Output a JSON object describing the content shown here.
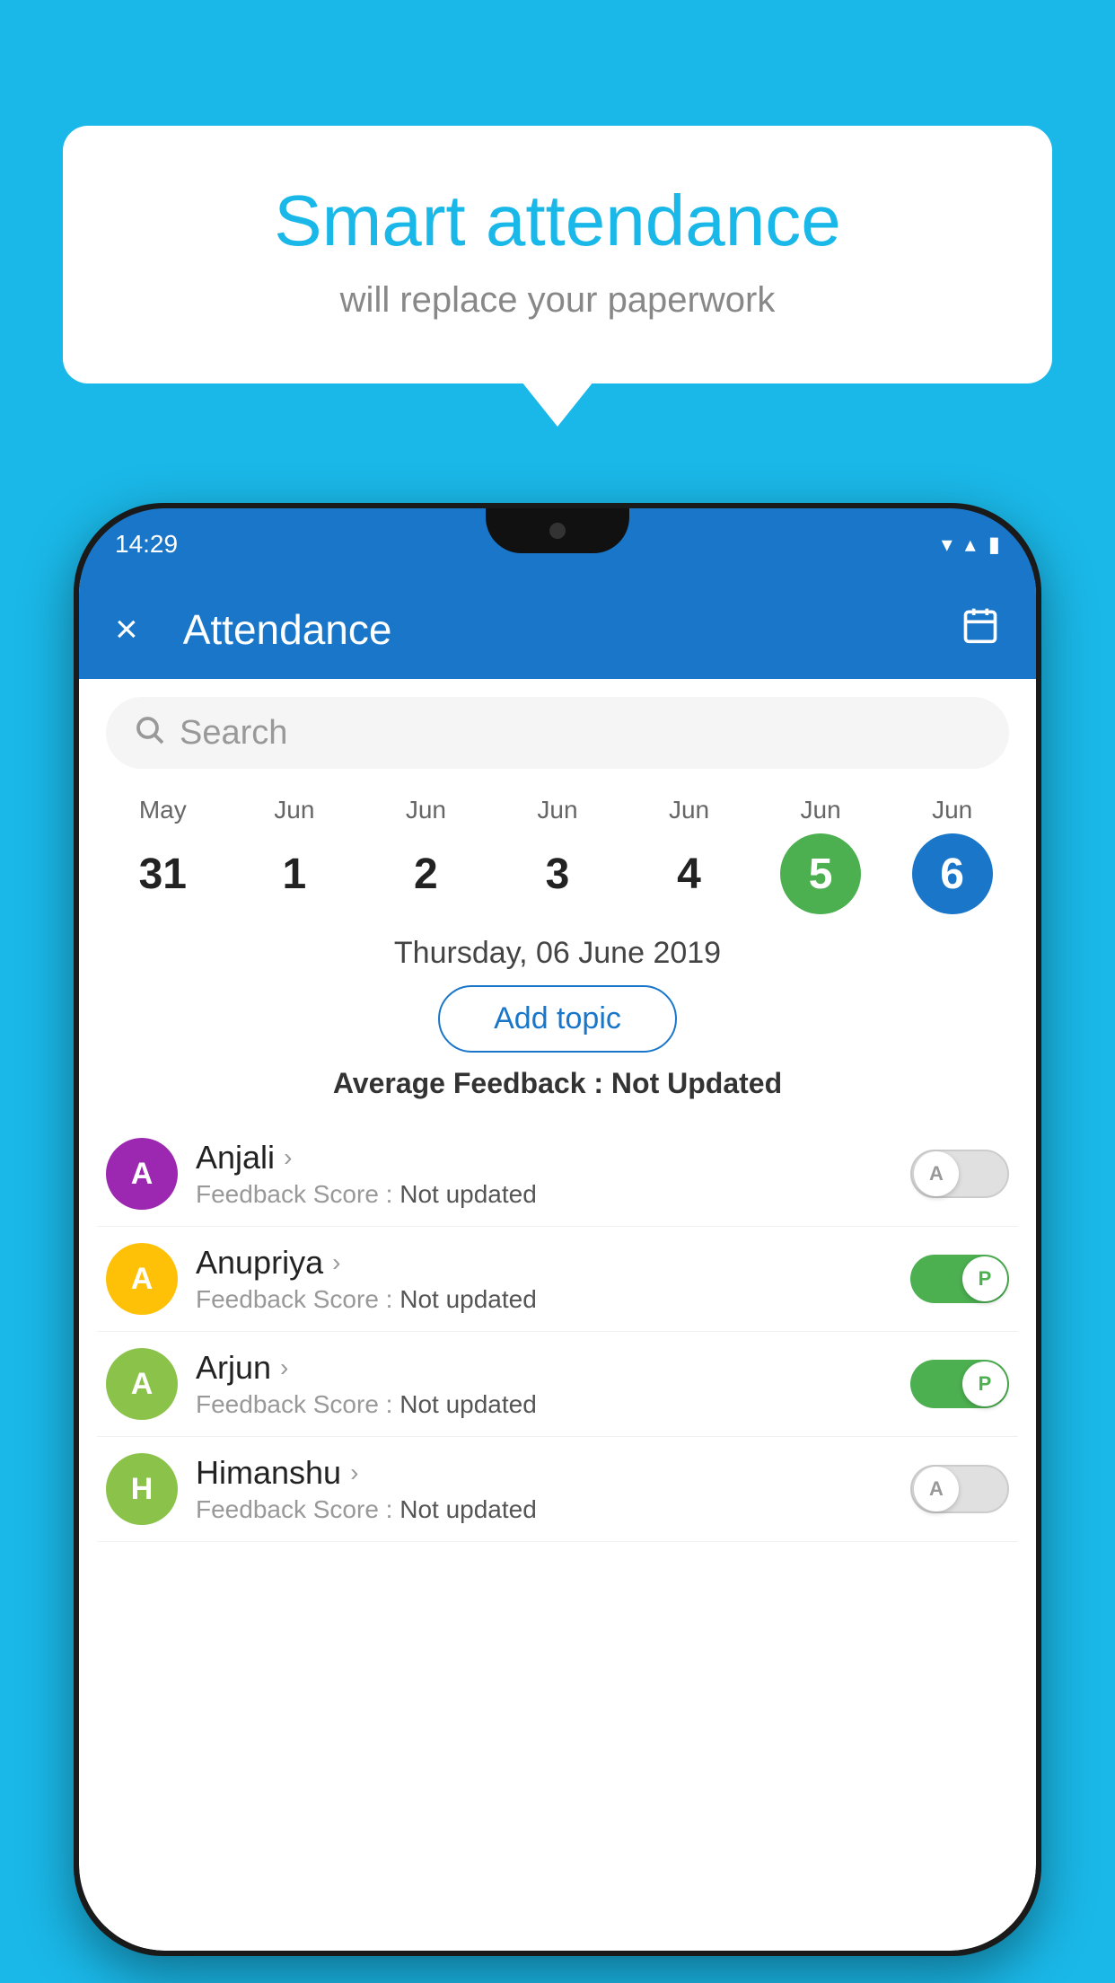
{
  "background": {
    "color": "#1ab8e8"
  },
  "speech_bubble": {
    "title": "Smart attendance",
    "subtitle": "will replace your paperwork"
  },
  "phone": {
    "status_bar": {
      "time": "14:29",
      "wifi_icon": "▼",
      "signal_icon": "▲",
      "battery_icon": "▮"
    },
    "header": {
      "close_label": "×",
      "title": "Attendance",
      "calendar_icon": "📅"
    },
    "search": {
      "placeholder": "Search"
    },
    "calendar": {
      "days": [
        {
          "month": "May",
          "date": "31",
          "style": "normal"
        },
        {
          "month": "Jun",
          "date": "1",
          "style": "normal"
        },
        {
          "month": "Jun",
          "date": "2",
          "style": "normal"
        },
        {
          "month": "Jun",
          "date": "3",
          "style": "normal"
        },
        {
          "month": "Jun",
          "date": "4",
          "style": "normal"
        },
        {
          "month": "Jun",
          "date": "5",
          "style": "green"
        },
        {
          "month": "Jun",
          "date": "6",
          "style": "blue"
        }
      ]
    },
    "selected_date": "Thursday, 06 June 2019",
    "add_topic_label": "Add topic",
    "avg_feedback_label": "Average Feedback :",
    "avg_feedback_value": "Not Updated",
    "students": [
      {
        "name": "Anjali",
        "avatar_letter": "A",
        "avatar_color": "#9c27b0",
        "feedback_label": "Feedback Score :",
        "feedback_value": "Not updated",
        "toggle_state": "off",
        "toggle_label": "A"
      },
      {
        "name": "Anupriya",
        "avatar_letter": "A",
        "avatar_color": "#ffc107",
        "feedback_label": "Feedback Score :",
        "feedback_value": "Not updated",
        "toggle_state": "on",
        "toggle_label": "P"
      },
      {
        "name": "Arjun",
        "avatar_letter": "A",
        "avatar_color": "#8bc34a",
        "feedback_label": "Feedback Score :",
        "feedback_value": "Not updated",
        "toggle_state": "on",
        "toggle_label": "P"
      },
      {
        "name": "Himanshu",
        "avatar_letter": "H",
        "avatar_color": "#8bc34a",
        "feedback_label": "Feedback Score :",
        "feedback_value": "Not updated",
        "toggle_state": "off",
        "toggle_label": "A"
      }
    ]
  }
}
